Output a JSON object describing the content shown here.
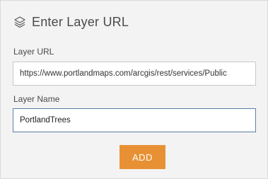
{
  "header": {
    "icon": "layers-icon",
    "title": "Enter Layer URL"
  },
  "form": {
    "url_label": "Layer URL",
    "url_value": "https://www.portlandmaps.com/arcgis/rest/services/Public",
    "name_label": "Layer Name",
    "name_value": "PortlandTrees",
    "add_label": "ADD"
  },
  "colors": {
    "panel_bg": "#f3f3f3",
    "accent_button": "#e89134",
    "focused_border": "#5a7fa8"
  }
}
